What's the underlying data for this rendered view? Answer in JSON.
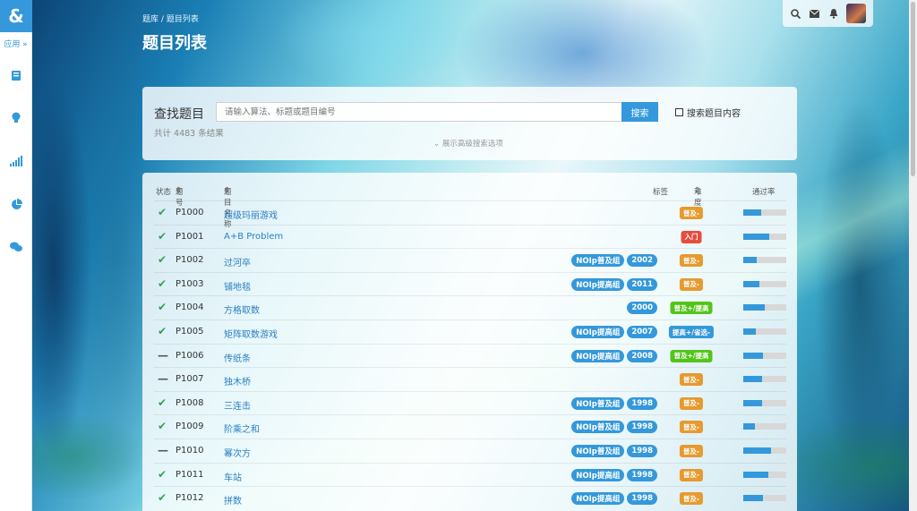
{
  "sidebar": {
    "logo": "&",
    "apps_label": "应用 »",
    "icons": [
      "book-icon",
      "lightbulb-icon",
      "bar-chart-icon",
      "pie-chart-icon",
      "chat-icon"
    ]
  },
  "header": {
    "breadcrumb": "题库 / 题目列表",
    "title": "题目列表"
  },
  "search": {
    "label": "查找题目",
    "placeholder": "请输入算法、标题或题目编号",
    "button": "搜索",
    "content_checkbox": "搜索题目内容",
    "count": "共计 4483 条结果",
    "advanced": "展示高级搜索选项"
  },
  "columns": {
    "status": "状态",
    "id": "题号",
    "name": "题目名称",
    "tags": "标签",
    "difficulty": "难度",
    "pass_rate": "通过率"
  },
  "difficulty_colors": {
    "普及-": "#e69a2f",
    "入门": "#e74c3c",
    "普及+/提高": "#52c41a",
    "提高+/省选-": "#3498db"
  },
  "rows": [
    {
      "status": "✔",
      "id": "P1000",
      "name": "超级玛丽游戏",
      "tags": [],
      "difficulty": "普及-",
      "rate": 0.42
    },
    {
      "status": "✔",
      "id": "P1001",
      "name": "A+B Problem",
      "tags": [],
      "difficulty": "入门",
      "rate": 0.6
    },
    {
      "status": "✔",
      "id": "P1002",
      "name": "过河卒",
      "tags": [
        "NOIp普及组",
        "2002"
      ],
      "difficulty": "普及-",
      "rate": 0.32
    },
    {
      "status": "✔",
      "id": "P1003",
      "name": "铺地毯",
      "tags": [
        "NOIp提高组",
        "2011"
      ],
      "difficulty": "普及-",
      "rate": 0.38
    },
    {
      "status": "✔",
      "id": "P1004",
      "name": "方格取数",
      "tags": [
        "2000"
      ],
      "difficulty": "普及+/提高",
      "rate": 0.5
    },
    {
      "status": "✔",
      "id": "P1005",
      "name": "矩阵取数游戏",
      "tags": [
        "NOIp提高组",
        "2007"
      ],
      "difficulty": "提高+/省选-",
      "rate": 0.3
    },
    {
      "status": "—",
      "id": "P1006",
      "name": "传纸条",
      "tags": [
        "NOIp提高组",
        "2008"
      ],
      "difficulty": "普及+/提高",
      "rate": 0.46
    },
    {
      "status": "—",
      "id": "P1007",
      "name": "独木桥",
      "tags": [],
      "difficulty": "普及-",
      "rate": 0.44
    },
    {
      "status": "✔",
      "id": "P1008",
      "name": "三连击",
      "tags": [
        "NOIp普及组",
        "1998"
      ],
      "difficulty": "普及-",
      "rate": 0.44
    },
    {
      "status": "✔",
      "id": "P1009",
      "name": "阶乘之和",
      "tags": [
        "NOIp普及组",
        "1998"
      ],
      "difficulty": "普及-",
      "rate": 0.28
    },
    {
      "status": "—",
      "id": "P1010",
      "name": "幂次方",
      "tags": [
        "NOIp普及组",
        "1998"
      ],
      "difficulty": "普及-",
      "rate": 0.65
    },
    {
      "status": "✔",
      "id": "P1011",
      "name": "车站",
      "tags": [
        "NOIp提高组",
        "1998"
      ],
      "difficulty": "普及-",
      "rate": 0.58
    },
    {
      "status": "✔",
      "id": "P1012",
      "name": "拼数",
      "tags": [
        "NOIp提高组",
        "1998"
      ],
      "difficulty": "普及-",
      "rate": 0.46
    }
  ]
}
